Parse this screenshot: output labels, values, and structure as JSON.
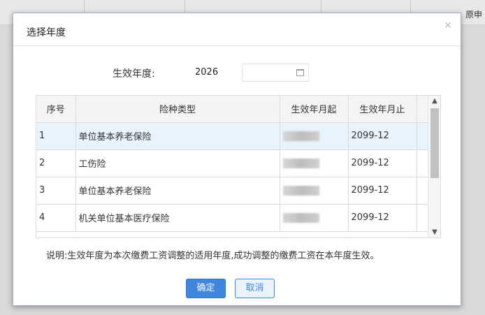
{
  "background": {
    "columns": [
      "",
      "",
      "",
      "",
      ""
    ],
    "right_label": "原申"
  },
  "dialog": {
    "title": "选择年度",
    "close_icon": "close-icon"
  },
  "year": {
    "label": "生效年度:",
    "value": "2026",
    "picker_icon": "calendar-icon"
  },
  "table": {
    "headers": [
      "序号",
      "险种类型",
      "生效年月起",
      "生效年月止"
    ],
    "rows": [
      {
        "no": "1",
        "type": "单位基本养老保险",
        "start": "",
        "end": "2099-12"
      },
      {
        "no": "2",
        "type": "工伤险",
        "start": "",
        "end": "2099-12"
      },
      {
        "no": "3",
        "type": "单位基本养老保险",
        "start": "",
        "end": "2099-12"
      },
      {
        "no": "4",
        "type": "机关单位基本医疗保险",
        "start": "",
        "end": "2099-12"
      }
    ]
  },
  "note": "说明:生效年度为本次缴费工资调整的适用年度,成功调整的缴费工资在本年度生效。",
  "buttons": {
    "ok": "确定",
    "cancel": "取消"
  }
}
